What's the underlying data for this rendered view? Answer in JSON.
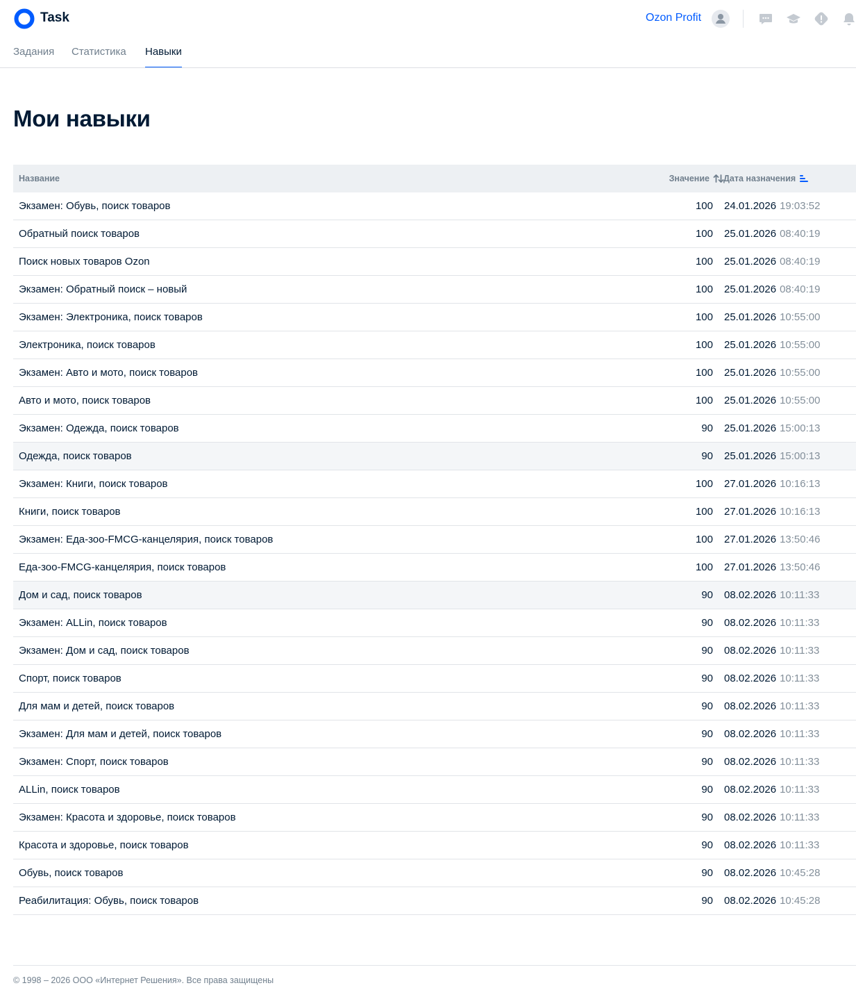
{
  "app": {
    "brand": "Task",
    "profit_link": "Ozon Profit",
    "icons": {
      "logo": "ozon-ring-logo",
      "avatar": "user-avatar-icon",
      "chat": "chat-icon",
      "education": "graduation-cap-icon",
      "alert": "warning-icon",
      "notifications": "bell-icon"
    }
  },
  "nav": {
    "tabs": [
      {
        "label": "Задания",
        "active": false
      },
      {
        "label": "Статистика",
        "active": false
      },
      {
        "label": "Навыки",
        "active": true
      }
    ]
  },
  "page": {
    "title": "Мои навыки"
  },
  "table": {
    "headers": {
      "name": "Название",
      "value": "Значение",
      "date": "Дата назначения"
    },
    "rows": [
      {
        "name": "Экзамен: Обувь, поиск товаров",
        "value": "100",
        "date": "24.01.2026",
        "time": "19:03:52",
        "highlighted": false
      },
      {
        "name": "Обратный поиск товаров",
        "value": "100",
        "date": "25.01.2026",
        "time": "08:40:19",
        "highlighted": false
      },
      {
        "name": "Поиск новых товаров Ozon",
        "value": "100",
        "date": "25.01.2026",
        "time": "08:40:19",
        "highlighted": false
      },
      {
        "name": "Экзамен: Обратный поиск – новый",
        "value": "100",
        "date": "25.01.2026",
        "time": "08:40:19",
        "highlighted": false
      },
      {
        "name": "Экзамен: Электроника, поиск товаров",
        "value": "100",
        "date": "25.01.2026",
        "time": "10:55:00",
        "highlighted": false
      },
      {
        "name": "Электроника, поиск товаров",
        "value": "100",
        "date": "25.01.2026",
        "time": "10:55:00",
        "highlighted": false
      },
      {
        "name": "Экзамен: Авто и мото, поиск товаров",
        "value": "100",
        "date": "25.01.2026",
        "time": "10:55:00",
        "highlighted": false
      },
      {
        "name": "Авто и мото, поиск товаров",
        "value": "100",
        "date": "25.01.2026",
        "time": "10:55:00",
        "highlighted": false
      },
      {
        "name": "Экзамен: Одежда, поиск товаров",
        "value": "90",
        "date": "25.01.2026",
        "time": "15:00:13",
        "highlighted": false
      },
      {
        "name": "Одежда, поиск товаров",
        "value": "90",
        "date": "25.01.2026",
        "time": "15:00:13",
        "highlighted": true
      },
      {
        "name": "Экзамен: Книги, поиск товаров",
        "value": "100",
        "date": "27.01.2026",
        "time": "10:16:13",
        "highlighted": false
      },
      {
        "name": "Книги, поиск товаров",
        "value": "100",
        "date": "27.01.2026",
        "time": "10:16:13",
        "highlighted": false
      },
      {
        "name": "Экзамен: Еда-зоо-FMCG-канцелярия, поиск товаров",
        "value": "100",
        "date": "27.01.2026",
        "time": "13:50:46",
        "highlighted": false
      },
      {
        "name": "Еда-зоо-FMCG-канцелярия, поиск товаров",
        "value": "100",
        "date": "27.01.2026",
        "time": "13:50:46",
        "highlighted": false
      },
      {
        "name": "Дом и сад, поиск товаров",
        "value": "90",
        "date": "08.02.2026",
        "time": "10:11:33",
        "highlighted": true
      },
      {
        "name": "Экзамен: ALLin, поиск товаров",
        "value": "90",
        "date": "08.02.2026",
        "time": "10:11:33",
        "highlighted": false
      },
      {
        "name": "Экзамен: Дом и сад, поиск товаров",
        "value": "90",
        "date": "08.02.2026",
        "time": "10:11:33",
        "highlighted": false
      },
      {
        "name": "Спорт, поиск товаров",
        "value": "90",
        "date": "08.02.2026",
        "time": "10:11:33",
        "highlighted": false
      },
      {
        "name": "Для мам и детей, поиск товаров",
        "value": "90",
        "date": "08.02.2026",
        "time": "10:11:33",
        "highlighted": false
      },
      {
        "name": "Экзамен: Для мам и детей, поиск товаров",
        "value": "90",
        "date": "08.02.2026",
        "time": "10:11:33",
        "highlighted": false
      },
      {
        "name": "Экзамен: Спорт, поиск товаров",
        "value": "90",
        "date": "08.02.2026",
        "time": "10:11:33",
        "highlighted": false
      },
      {
        "name": "ALLin, поиск товаров",
        "value": "90",
        "date": "08.02.2026",
        "time": "10:11:33",
        "highlighted": false
      },
      {
        "name": "Экзамен: Красота и здоровье, поиск товаров",
        "value": "90",
        "date": "08.02.2026",
        "time": "10:11:33",
        "highlighted": false
      },
      {
        "name": "Красота и здоровье, поиск товаров",
        "value": "90",
        "date": "08.02.2026",
        "time": "10:11:33",
        "highlighted": false
      },
      {
        "name": "Обувь, поиск товаров",
        "value": "90",
        "date": "08.02.2026",
        "time": "10:45:28",
        "highlighted": false
      },
      {
        "name": "Реабилитация: Обувь, поиск товаров",
        "value": "90",
        "date": "08.02.2026",
        "time": "10:45:28",
        "highlighted": false
      }
    ]
  },
  "footer": {
    "copyright": "© 1998 – 2026 ООО «Интернет Решения». Все права защищены"
  },
  "colors": {
    "accent": "#005bff",
    "text": "#001a34",
    "muted": "#707f8d",
    "header_bg": "#edf0f3",
    "row_highlight": "#f4f6f8"
  }
}
